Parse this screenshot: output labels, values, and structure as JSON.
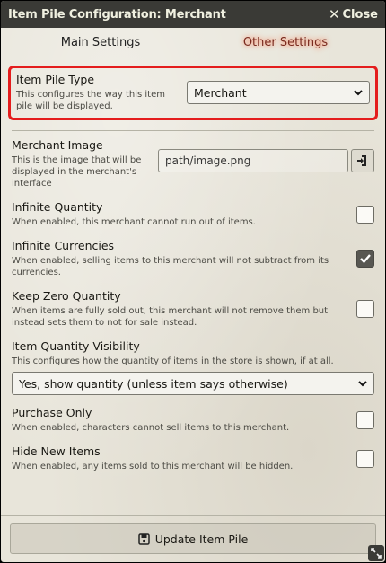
{
  "window": {
    "title": "Item Pile Configuration: Merchant",
    "close_label": "Close"
  },
  "tabs": [
    {
      "label": "Main Settings"
    },
    {
      "label": "Other Settings"
    }
  ],
  "settings": {
    "pile_type": {
      "label": "Item Pile Type",
      "hint": "This configures the way this item pile will be displayed.",
      "value": "Merchant"
    },
    "merchant_image": {
      "label": "Merchant Image",
      "hint": "This is the image that will be displayed in the merchant's interface",
      "value": "path/image.png"
    },
    "infinite_quantity": {
      "label": "Infinite Quantity",
      "hint": "When enabled, this merchant cannot run out of items.",
      "checked": false
    },
    "infinite_currencies": {
      "label": "Infinite Currencies",
      "hint": "When enabled, selling items to this merchant will not subtract from its currencies.",
      "checked": true
    },
    "keep_zero_quantity": {
      "label": "Keep Zero Quantity",
      "hint": "When items are fully sold out, this merchant will not remove them but instead sets them to not for sale instead.",
      "checked": false
    },
    "quantity_visibility": {
      "label": "Item Quantity Visibility",
      "hint": "This configures how the quantity of items in the store is shown, if at all.",
      "value": "Yes, show quantity (unless item says otherwise)"
    },
    "purchase_only": {
      "label": "Purchase Only",
      "hint": "When enabled, characters cannot sell items to this merchant.",
      "checked": false
    },
    "hide_new_items": {
      "label": "Hide New Items",
      "hint": "When enabled, any items sold to this merchant will be hidden.",
      "checked": false
    }
  },
  "footer": {
    "update_label": "Update Item Pile"
  },
  "colors": {
    "highlight": "#e41d1d",
    "active_tab_glow": "#ff6a3d",
    "titlebar": "#3a3a36"
  },
  "icons": [
    "close-icon",
    "chevron-down-icon",
    "file-picker-icon",
    "check-icon",
    "save-icon",
    "resize-icon"
  ]
}
